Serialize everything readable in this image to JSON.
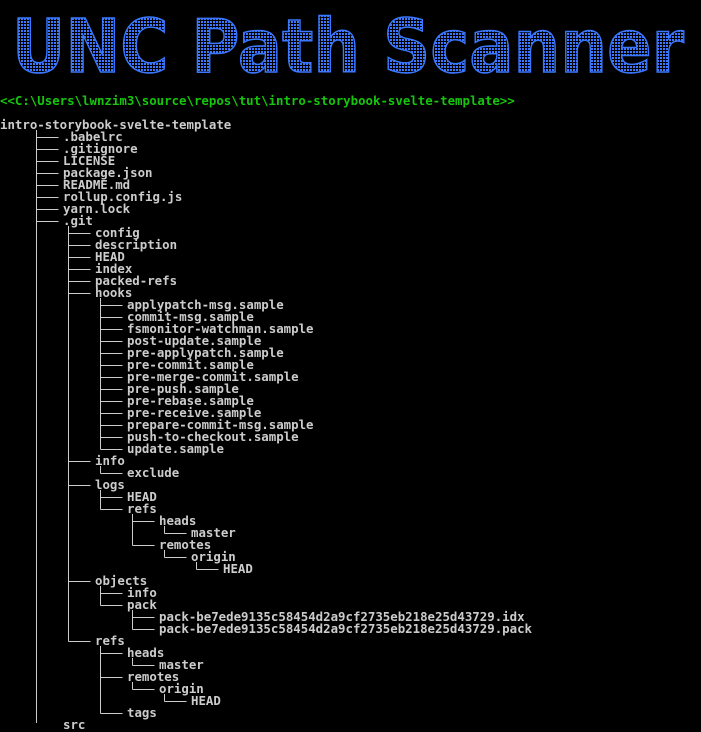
{
  "colors": {
    "background": "#000000",
    "banner": "#3b78ff",
    "path": "#16c60c",
    "text": "#cccccc"
  },
  "banner": {
    "title": "UNC Path Scanner"
  },
  "path_prompt": "<<C:\\Users\\lwnzim3\\source\\repos\\tut\\intro-storybook-svelte-template>>",
  "tree": {
    "name": "intro-storybook-svelte-template",
    "children": [
      {
        "name": ".babelrc"
      },
      {
        "name": ".gitignore"
      },
      {
        "name": "LICENSE"
      },
      {
        "name": "package.json"
      },
      {
        "name": "README.md"
      },
      {
        "name": "rollup.config.js"
      },
      {
        "name": "yarn.lock"
      },
      {
        "name": ".git",
        "children": [
          {
            "name": "config"
          },
          {
            "name": "description"
          },
          {
            "name": "HEAD"
          },
          {
            "name": "index"
          },
          {
            "name": "packed-refs"
          },
          {
            "name": "hooks",
            "children": [
              {
                "name": "applypatch-msg.sample"
              },
              {
                "name": "commit-msg.sample"
              },
              {
                "name": "fsmonitor-watchman.sample"
              },
              {
                "name": "post-update.sample"
              },
              {
                "name": "pre-applypatch.sample"
              },
              {
                "name": "pre-commit.sample"
              },
              {
                "name": "pre-merge-commit.sample"
              },
              {
                "name": "pre-push.sample"
              },
              {
                "name": "pre-rebase.sample"
              },
              {
                "name": "pre-receive.sample"
              },
              {
                "name": "prepare-commit-msg.sample"
              },
              {
                "name": "push-to-checkout.sample"
              },
              {
                "name": "update.sample"
              }
            ]
          },
          {
            "name": "info",
            "children": [
              {
                "name": "exclude"
              }
            ]
          },
          {
            "name": "logs",
            "children": [
              {
                "name": "HEAD"
              },
              {
                "name": "refs",
                "children": [
                  {
                    "name": "heads",
                    "children": [
                      {
                        "name": "master"
                      }
                    ]
                  },
                  {
                    "name": "remotes",
                    "children": [
                      {
                        "name": "origin",
                        "children": [
                          {
                            "name": "HEAD"
                          }
                        ]
                      }
                    ]
                  }
                ]
              }
            ]
          },
          {
            "name": "objects",
            "children": [
              {
                "name": "info"
              },
              {
                "name": "pack",
                "children": [
                  {
                    "name": "pack-be7ede9135c58454d2a9cf2735eb218e25d43729.idx"
                  },
                  {
                    "name": "pack-be7ede9135c58454d2a9cf2735eb218e25d43729.pack"
                  }
                ]
              }
            ]
          },
          {
            "name": "refs",
            "children": [
              {
                "name": "heads",
                "children": [
                  {
                    "name": "master"
                  }
                ]
              },
              {
                "name": "remotes",
                "children": [
                  {
                    "name": "origin",
                    "children": [
                      {
                        "name": "HEAD"
                      }
                    ]
                  }
                ]
              },
              {
                "name": "tags"
              }
            ]
          }
        ]
      },
      {
        "name": "src"
      }
    ]
  }
}
